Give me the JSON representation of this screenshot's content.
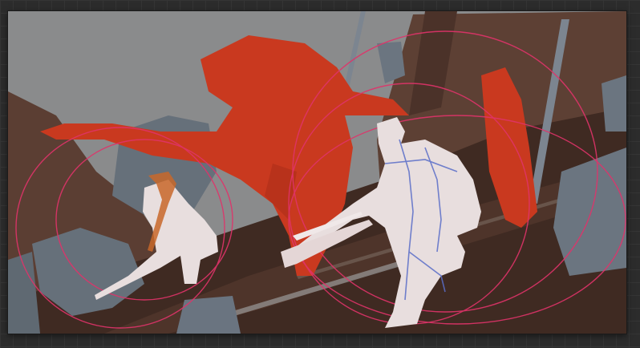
{
  "colors": {
    "workspace_bg": "#2c2c2c",
    "sky": "#8a8b8c",
    "ground_dark": "#3f2a22",
    "ground_brown": "#5a3d33",
    "rock_blue_gray": "#66707a",
    "creature_red": "#c9391f",
    "figure_white": "#e8dede",
    "figure_orange": "#c8672a",
    "guide_circle_pink": "#e0336a",
    "sketch_blue": "#5a6ec8"
  },
  "icons": {
    "canvas": "painting-canvas"
  }
}
